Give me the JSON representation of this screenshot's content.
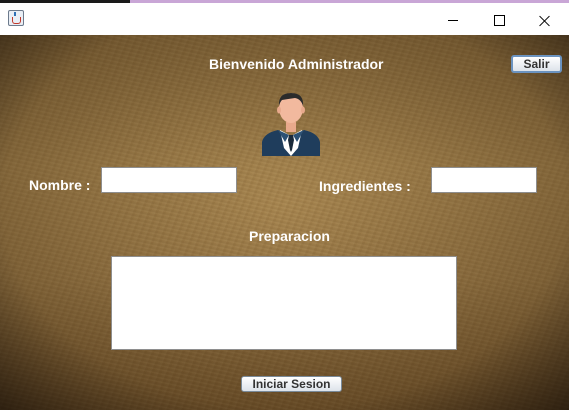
{
  "window": {
    "app_icon": "java-cup-icon",
    "controls": [
      "minimize-icon",
      "maximize-icon",
      "close-icon"
    ]
  },
  "header": {
    "welcome_text": "Bienvenido Administrador",
    "logout_label": "Salir",
    "avatar_icon": "user-avatar-icon"
  },
  "form": {
    "nombre_label": "Nombre :",
    "nombre_value": "",
    "ingredientes_label": "Ingredientes :",
    "ingredientes_value": "",
    "preparacion_label": "Preparacion",
    "preparacion_value": ""
  },
  "footer": {
    "login_label": "Iniciar Sesion"
  },
  "colors": {
    "label_text": "#ffffff",
    "background_base": "#a8864f",
    "avatar_suit": "#1f3d5c",
    "avatar_skin": "#f2b99e"
  }
}
